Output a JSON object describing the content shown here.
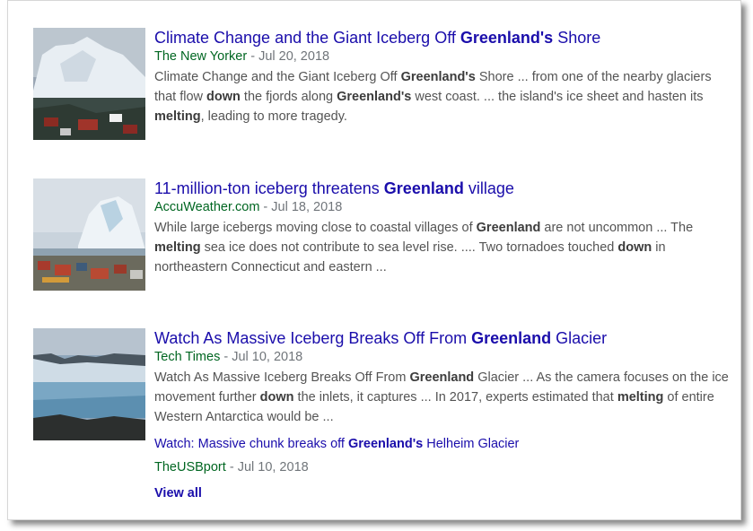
{
  "results": [
    {
      "title_parts": [
        "Climate Change and the Giant Iceberg Off ",
        "Greenland's",
        " Shore"
      ],
      "source": "The New Yorker",
      "separator": " - ",
      "date": "Jul 20, 2018",
      "snippet_parts": [
        "Climate Change and the Giant Iceberg Off ",
        "Greenland's",
        " Shore ... from one of the nearby glaciers that flow ",
        "down",
        " the fjords along ",
        "Greenland's",
        " west coast. ... the island's ice sheet and hasten its ",
        "melting",
        ", leading to more tragedy."
      ],
      "thumb_icon": "iceberg-village-photo"
    },
    {
      "title_parts": [
        "11-million-ton iceberg threatens ",
        "Greenland",
        " village"
      ],
      "source": "AccuWeather.com",
      "separator": " - ",
      "date": "Jul 18, 2018",
      "snippet_parts": [
        "While large icebergs moving close to coastal villages of ",
        "Greenland",
        " are not uncommon ... The ",
        "melting",
        " sea ice does not contribute to sea level rise. .... Two tornadoes touched ",
        "down",
        " in northeastern Connecticut and eastern ..."
      ],
      "thumb_icon": "iceberg-houses-photo"
    },
    {
      "title_parts": [
        "Watch As Massive Iceberg Breaks Off From ",
        "Greenland",
        " Glacier"
      ],
      "source": "Tech Times",
      "separator": " - ",
      "date": "Jul 10, 2018",
      "snippet_parts": [
        "Watch As Massive Iceberg Breaks Off From ",
        "Greenland",
        " Glacier ... As the camera focuses on the ice movement further ",
        "down",
        " the inlets, it captures ... In 2017, experts estimated that ",
        "melting",
        " of entire Western Antarctica would be ..."
      ],
      "thumb_icon": "glacier-photo",
      "sub_link": {
        "title_parts": [
          "Watch: Massive chunk breaks off ",
          "Greenland's",
          " Helheim Glacier"
        ],
        "source": "TheUSBport",
        "separator": " - ",
        "date": "Jul 10, 2018"
      }
    }
  ],
  "view_all": "View all",
  "colors": {
    "link": "#1a0dab",
    "source": "#006621",
    "snippet": "#545454",
    "date": "#70757a"
  }
}
